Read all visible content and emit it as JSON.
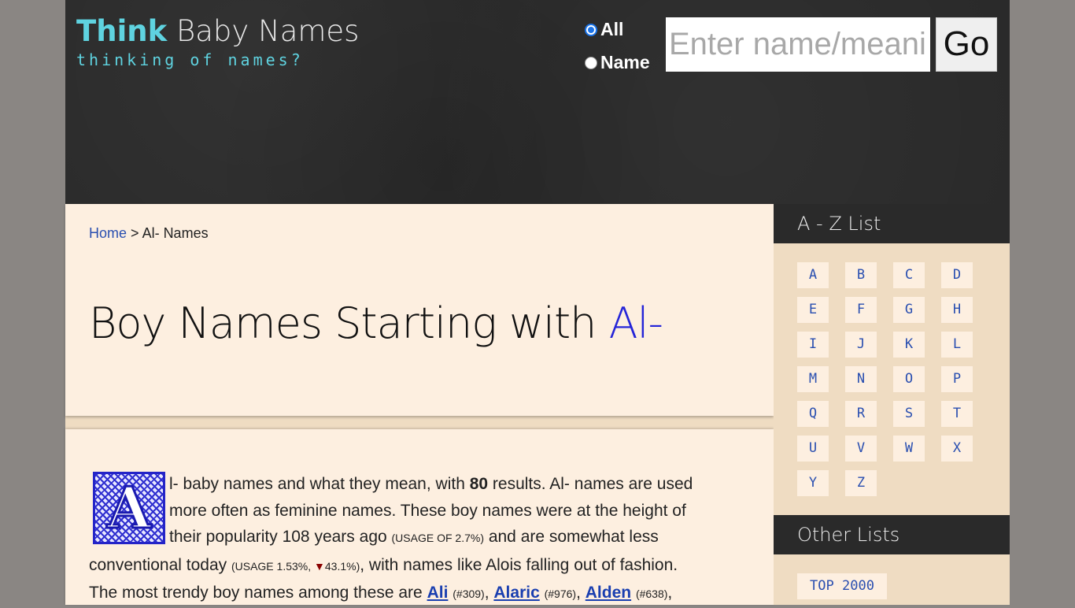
{
  "header": {
    "logo": {
      "think": "Think",
      "rest": " Baby Names",
      "tagline": "thinking of names?"
    },
    "search": {
      "radio_all": "All",
      "radio_name": "Name",
      "placeholder": "Enter name/meaning",
      "go_label": "Go",
      "selected": "All"
    }
  },
  "breadcrumb": {
    "home": "Home",
    "separator": ">",
    "current": "Al- Names"
  },
  "title": {
    "prefix": "Boy Names Starting with ",
    "accent": "Al-"
  },
  "intro": {
    "drop_cap": "A",
    "l1": "l- baby names and what they mean, with ",
    "count": "80",
    "l1b": " results. Al- names are used",
    "l2": "more often as feminine names. These boy names were at the height of",
    "l3a": "their popularity 108 years ago ",
    "usage_past": "(USAGE OF 2.7%)",
    "l3b": " and are somewhat less",
    "l4a": "conventional today ",
    "usage_now": "(USAGE 1.53%, ",
    "down_arrow": "▼",
    "usage_change": "43.1%)",
    "l4b": ", with names like Alois falling out of fashion.",
    "l5": "The most trendy boy names among these are ",
    "names": [
      {
        "name": "Ali",
        "rank": "(#309)"
      },
      {
        "name": "Alaric",
        "rank": "(#976)"
      },
      {
        "name": "Alden",
        "rank": "(#638)"
      }
    ]
  },
  "sidebar": {
    "az_heading": "A - Z List",
    "letters": [
      "A",
      "B",
      "C",
      "D",
      "E",
      "F",
      "G",
      "H",
      "I",
      "J",
      "K",
      "L",
      "M",
      "N",
      "O",
      "P",
      "Q",
      "R",
      "S",
      "T",
      "U",
      "V",
      "W",
      "X",
      "Y",
      "Z"
    ],
    "other_heading": "Other Lists",
    "other_items": [
      "TOP 2000"
    ]
  },
  "colors": {
    "accent": "#2424d8",
    "link": "#2a4fb0",
    "logo_teal": "#5fd3e0",
    "header_bg": "#2a2a2a"
  }
}
